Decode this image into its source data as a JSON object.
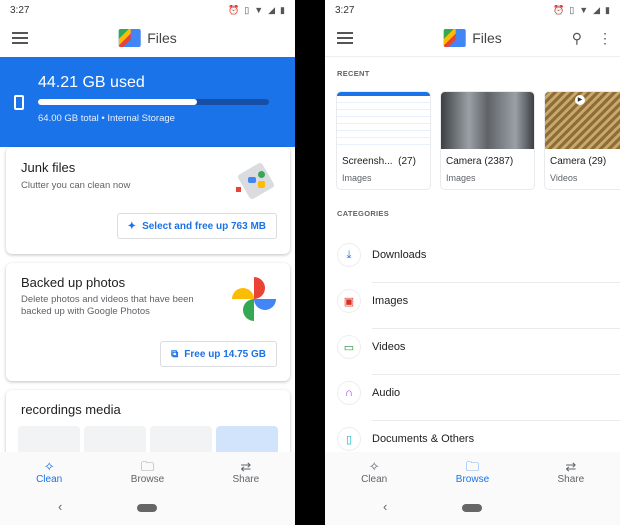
{
  "status_bar": {
    "time": "3:27",
    "icons": [
      "alarm-icon",
      "vibrate-icon",
      "wifi-icon",
      "signal-icon",
      "battery-icon"
    ]
  },
  "app": {
    "title": "Files"
  },
  "clean_screen": {
    "storage": {
      "used_label": "44.21 GB used",
      "total_label": "64.00 GB total • Internal Storage",
      "used_fraction": 0.69
    },
    "junk_card": {
      "title": "Junk files",
      "subtitle": "Clutter you can clean now",
      "button": "Select and free up 763 MB"
    },
    "photos_card": {
      "title": "Backed up photos",
      "subtitle_line1": "Delete photos and videos that have been",
      "subtitle_line2": "backed up with Google Photos",
      "button": "Free up 14.75 GB"
    },
    "recordings_card": {
      "title": "recordings media"
    }
  },
  "browse_screen": {
    "recent_label": "RECENT",
    "recent": [
      {
        "name": "Screensh...",
        "count": "(27)",
        "type": "Images"
      },
      {
        "name": "Camera",
        "count": "(2387)",
        "type": "Images"
      },
      {
        "name": "Camera",
        "count": "(29)",
        "type": "Videos"
      }
    ],
    "categories_label": "CATEGORIES",
    "categories": [
      {
        "label": "Downloads",
        "icon": "download-icon",
        "color": "#1a73e8"
      },
      {
        "label": "Images",
        "icon": "image-icon",
        "color": "#d93025"
      },
      {
        "label": "Videos",
        "icon": "video-icon",
        "color": "#1e8e3e"
      },
      {
        "label": "Audio",
        "icon": "headphones-icon",
        "color": "#9334e6"
      },
      {
        "label": "Documents & Others",
        "icon": "document-icon",
        "color": "#12b5cb"
      }
    ]
  },
  "bottom_nav": [
    {
      "label": "Clean",
      "icon": "sparkle-icon"
    },
    {
      "label": "Browse",
      "icon": "folder-search-icon"
    },
    {
      "label": "Share",
      "icon": "swap-arrows-icon"
    }
  ],
  "colors": {
    "accent": "#1a73e8",
    "storage_bg": "#1a73e8"
  }
}
